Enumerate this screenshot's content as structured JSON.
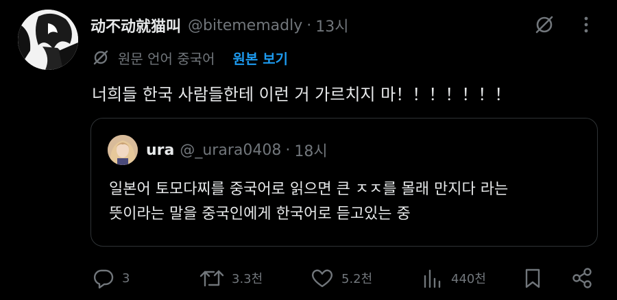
{
  "post": {
    "display_name": "动不动就猫叫",
    "handle": "@bitememadly",
    "separator": "·",
    "time": "13시",
    "translation_note": "원문 언어 중국어",
    "show_original": "원본 보기",
    "text": "너희들 한국 사람들한테 이런 거 가르치지 마！！！！！！！"
  },
  "quote": {
    "display_name": "ura",
    "handle": "@_urara0408",
    "separator": "·",
    "time": "18시",
    "lines": [
      "일본어 토모다찌를 중국어로 읽으면 큰 ㅈㅈ를 몰래 만지다 라는",
      "뜻이라는 말을 중국인에게 한국어로 듣고있는 중"
    ]
  },
  "actions": {
    "replies": "3",
    "reposts": "3.3천",
    "likes": "5.2천",
    "views": "440천"
  },
  "colors": {
    "background": "#000000",
    "text": "#e7e9ea",
    "muted": "#71767b",
    "accent": "#1d9bf0",
    "border": "#2f3336"
  },
  "icons": [
    "grok-icon",
    "more-icon",
    "translate-icon",
    "reply-icon",
    "repost-icon",
    "like-icon",
    "views-icon",
    "bookmark-icon",
    "share-icon"
  ]
}
